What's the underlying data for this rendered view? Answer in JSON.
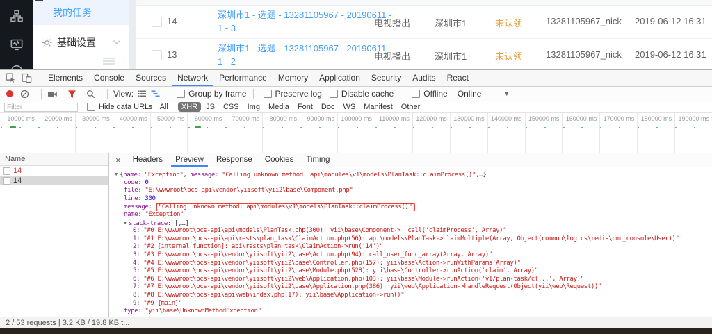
{
  "app": {
    "sidebar": {
      "active_item": "我的任务",
      "settings_item": "基础设置"
    },
    "table": {
      "rows": [
        {
          "id": "14",
          "title_line1": "深圳市1 - 选题 - 13281105967 - 20190611 -",
          "title_line2": "1 - 3",
          "channel": "电视播出",
          "city": "深圳市1",
          "status": "未认领",
          "nick": "13281105967_nick",
          "time": "2019-06-12 16:31"
        },
        {
          "id": "13",
          "title_line1": "深圳市1 - 选题 - 13281105967 - 20190611 -",
          "title_line2": "1 - 2",
          "channel": "电视播出",
          "city": "深圳市1",
          "status": "未认领",
          "nick": "13281105967_nick",
          "time": "2019-06-12 16:31"
        }
      ]
    }
  },
  "devtools": {
    "tabs": [
      "Elements",
      "Console",
      "Sources",
      "Network",
      "Performance",
      "Memory",
      "Application",
      "Security",
      "Audits",
      "React"
    ],
    "active_tab": "Network",
    "toolbar": {
      "view_label": "View:",
      "group_by_frame": "Group by frame",
      "preserve_log": "Preserve log",
      "disable_cache": "Disable cache",
      "offline": "Offline",
      "online": "Online"
    },
    "filter": {
      "placeholder": "Filter",
      "hide_data_urls": "Hide data URLs",
      "types": [
        "All",
        "XHR",
        "JS",
        "CSS",
        "Img",
        "Media",
        "Font",
        "Doc",
        "WS",
        "Manifest",
        "Other"
      ],
      "active_type": "XHR"
    },
    "timeline": {
      "ticks": [
        "10000 ms",
        "20000 ms",
        "30000 ms",
        "40000 ms",
        "50000 ms",
        "60000 ms",
        "70000 ms",
        "80000 ms",
        "90000 ms",
        "100000 ms",
        "110000 ms",
        "120000 ms",
        "130000 ms",
        "140000 ms",
        "150000 ms",
        "160000 ms",
        "170000 ms",
        "180000 ms",
        "190000 ms"
      ]
    },
    "requests": {
      "header": "Name",
      "items": [
        {
          "name": "14",
          "state": "error"
        },
        {
          "name": "14",
          "state": "selected"
        }
      ]
    },
    "detail": {
      "tabs": [
        "Headers",
        "Preview",
        "Response",
        "Cookies",
        "Timing"
      ],
      "active_tab": "Preview",
      "close_label": "×"
    },
    "preview": {
      "lines": [
        {
          "indent": 0,
          "arrow": true,
          "segs": [
            [
              "p",
              "{"
            ],
            [
              "k",
              "name"
            ],
            [
              "p",
              ": "
            ],
            [
              "s",
              "\"Exception\""
            ],
            [
              "p",
              ", "
            ],
            [
              "k",
              "message"
            ],
            [
              "p",
              ": "
            ],
            [
              "s",
              "\"Calling unknown method: api\\modules\\v1\\models\\PlanTask::claimProcess()\""
            ],
            [
              "p",
              ",…}"
            ]
          ]
        },
        {
          "indent": 1,
          "segs": [
            [
              "k",
              "code"
            ],
            [
              "p",
              ": "
            ],
            [
              "n",
              "0"
            ]
          ]
        },
        {
          "indent": 1,
          "segs": [
            [
              "k",
              "file"
            ],
            [
              "p",
              ": "
            ],
            [
              "s",
              "\"E:\\wwwroot\\pcs-api\\vendor\\yiisoft\\yii2\\base\\Component.php\""
            ]
          ]
        },
        {
          "indent": 1,
          "segs": [
            [
              "k",
              "line"
            ],
            [
              "p",
              ": "
            ],
            [
              "n",
              "300"
            ]
          ]
        },
        {
          "indent": 1,
          "segs": [
            [
              "k",
              "message"
            ],
            [
              "p",
              ": "
            ],
            [
              "h",
              "\"Calling unknown method: api\\modules\\v1\\models\\PlanTask::claimProcess()\""
            ]
          ]
        },
        {
          "indent": 1,
          "segs": [
            [
              "k",
              "name"
            ],
            [
              "p",
              ": "
            ],
            [
              "s",
              "\"Exception\""
            ]
          ]
        },
        {
          "indent": 1,
          "arrow": true,
          "segs": [
            [
              "k",
              "stack-trace"
            ],
            [
              "p",
              ": "
            ],
            [
              "p",
              "[,…]"
            ]
          ]
        },
        {
          "indent": 2,
          "segs": [
            [
              "k",
              "0"
            ],
            [
              "p",
              ": "
            ],
            [
              "s",
              "\"#0 E:\\wwwroot\\pcs-api\\api\\models\\PlanTask.php(300): yii\\base\\Component->__call('claimProcess', Array)\""
            ]
          ]
        },
        {
          "indent": 2,
          "segs": [
            [
              "k",
              "1"
            ],
            [
              "p",
              ": "
            ],
            [
              "s",
              "\"#1 E:\\wwwroot\\pcs-api\\api\\rests\\plan_task\\ClaimAction.php(56): api\\models\\PlanTask->claimMultiple(Array, Object(common\\logics\\redis\\cmc_console\\User))\""
            ]
          ]
        },
        {
          "indent": 2,
          "segs": [
            [
              "k",
              "2"
            ],
            [
              "p",
              ": "
            ],
            [
              "s",
              "\"#2 [internal function]: api\\rests\\plan_task\\ClaimAction->run('14')\""
            ]
          ]
        },
        {
          "indent": 2,
          "segs": [
            [
              "k",
              "3"
            ],
            [
              "p",
              ": "
            ],
            [
              "s",
              "\"#3 E:\\wwwroot\\pcs-api\\vendor\\yiisoft\\yii2\\base\\Action.php(94): call_user_func_array(Array, Array)\""
            ]
          ]
        },
        {
          "indent": 2,
          "segs": [
            [
              "k",
              "4"
            ],
            [
              "p",
              ": "
            ],
            [
              "s",
              "\"#4 E:\\wwwroot\\pcs-api\\vendor\\yiisoft\\yii2\\base\\Controller.php(157): yii\\base\\Action->runWithParams(Array)\""
            ]
          ]
        },
        {
          "indent": 2,
          "segs": [
            [
              "k",
              "5"
            ],
            [
              "p",
              ": "
            ],
            [
              "s",
              "\"#5 E:\\wwwroot\\pcs-api\\vendor\\yiisoft\\yii2\\base\\Module.php(528): yii\\base\\Controller->runAction('claim', Array)\""
            ]
          ]
        },
        {
          "indent": 2,
          "segs": [
            [
              "k",
              "6"
            ],
            [
              "p",
              ": "
            ],
            [
              "s",
              "\"#6 E:\\wwwroot\\pcs-api\\vendor\\yiisoft\\yii2\\web\\Application.php(103): yii\\base\\Module->runAction('v1/plan-task/cl...', Array)\""
            ]
          ]
        },
        {
          "indent": 2,
          "segs": [
            [
              "k",
              "7"
            ],
            [
              "p",
              ": "
            ],
            [
              "s",
              "\"#7 E:\\wwwroot\\pcs-api\\vendor\\yiisoft\\yii2\\base\\Application.php(386): yii\\web\\Application->handleRequest(Object(yii\\web\\Request))\""
            ]
          ]
        },
        {
          "indent": 2,
          "segs": [
            [
              "k",
              "8"
            ],
            [
              "p",
              ": "
            ],
            [
              "s",
              "\"#8 E:\\wwwroot\\pcs-api\\api\\web\\index.php(17): yii\\base\\Application->run()\""
            ]
          ]
        },
        {
          "indent": 2,
          "segs": [
            [
              "k",
              "9"
            ],
            [
              "p",
              ": "
            ],
            [
              "s",
              "\"#9 {main}\""
            ]
          ]
        },
        {
          "indent": 1,
          "segs": [
            [
              "k",
              "type"
            ],
            [
              "p",
              ": "
            ],
            [
              "s",
              "\"yii\\base\\UnknownMethodException\""
            ]
          ]
        }
      ]
    },
    "status_text": "2 / 53 requests | 3.2 KB / 19.8 KB t..."
  },
  "colors": {
    "link_blue": "#409eff",
    "status_orange": "#e6a23c",
    "devtools_active_tab_blue": "#4285f4",
    "error_red": "#d93a2f",
    "json_key_purple": "#881391",
    "json_string_red": "#c41a16",
    "json_number_blue": "#1c00cf",
    "search_highlight_border": "#ee4237",
    "waterfall_green": "#4db6ac",
    "filter_pill_gray": "#757575",
    "rail_dark": "#15191e",
    "bottom_bar_brown": "#2b231d"
  }
}
